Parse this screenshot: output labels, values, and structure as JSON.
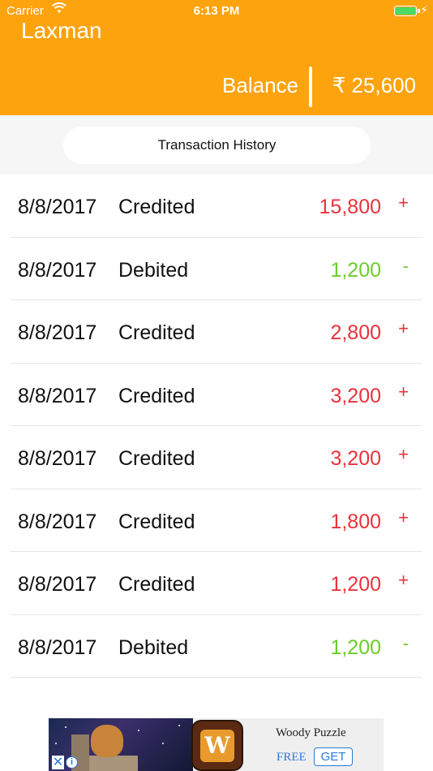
{
  "status_bar": {
    "carrier": "Carrier",
    "time": "6:13 PM"
  },
  "header": {
    "user_name": "Laxman",
    "balance_label": "Balance",
    "balance_value": "₹ 25,600",
    "background_color": "#fca30e"
  },
  "tab": {
    "label": "Transaction History"
  },
  "transactions": [
    {
      "date": "8/8/2017",
      "type": "Credited",
      "amount": "15,800",
      "sign": "+"
    },
    {
      "date": "8/8/2017",
      "type": "Debited",
      "amount": "1,200",
      "sign": "-"
    },
    {
      "date": "8/8/2017",
      "type": "Credited",
      "amount": "2,800",
      "sign": "+"
    },
    {
      "date": "8/8/2017",
      "type": "Credited",
      "amount": "3,200",
      "sign": "+"
    },
    {
      "date": "8/8/2017",
      "type": "Credited",
      "amount": "3,200",
      "sign": "+"
    },
    {
      "date": "8/8/2017",
      "type": "Credited",
      "amount": "1,800",
      "sign": "+"
    },
    {
      "date": "8/8/2017",
      "type": "Credited",
      "amount": "1,200",
      "sign": "+"
    },
    {
      "date": "8/8/2017",
      "type": "Debited",
      "amount": "1,200",
      "sign": "-"
    }
  ],
  "colors": {
    "credit": "#e8323c",
    "debit": "#6ccc2a"
  },
  "ad": {
    "title": "Woody Puzzle",
    "price": "FREE",
    "cta": "GET",
    "close_icon": "close-icon",
    "info_icon": "info-icon"
  }
}
